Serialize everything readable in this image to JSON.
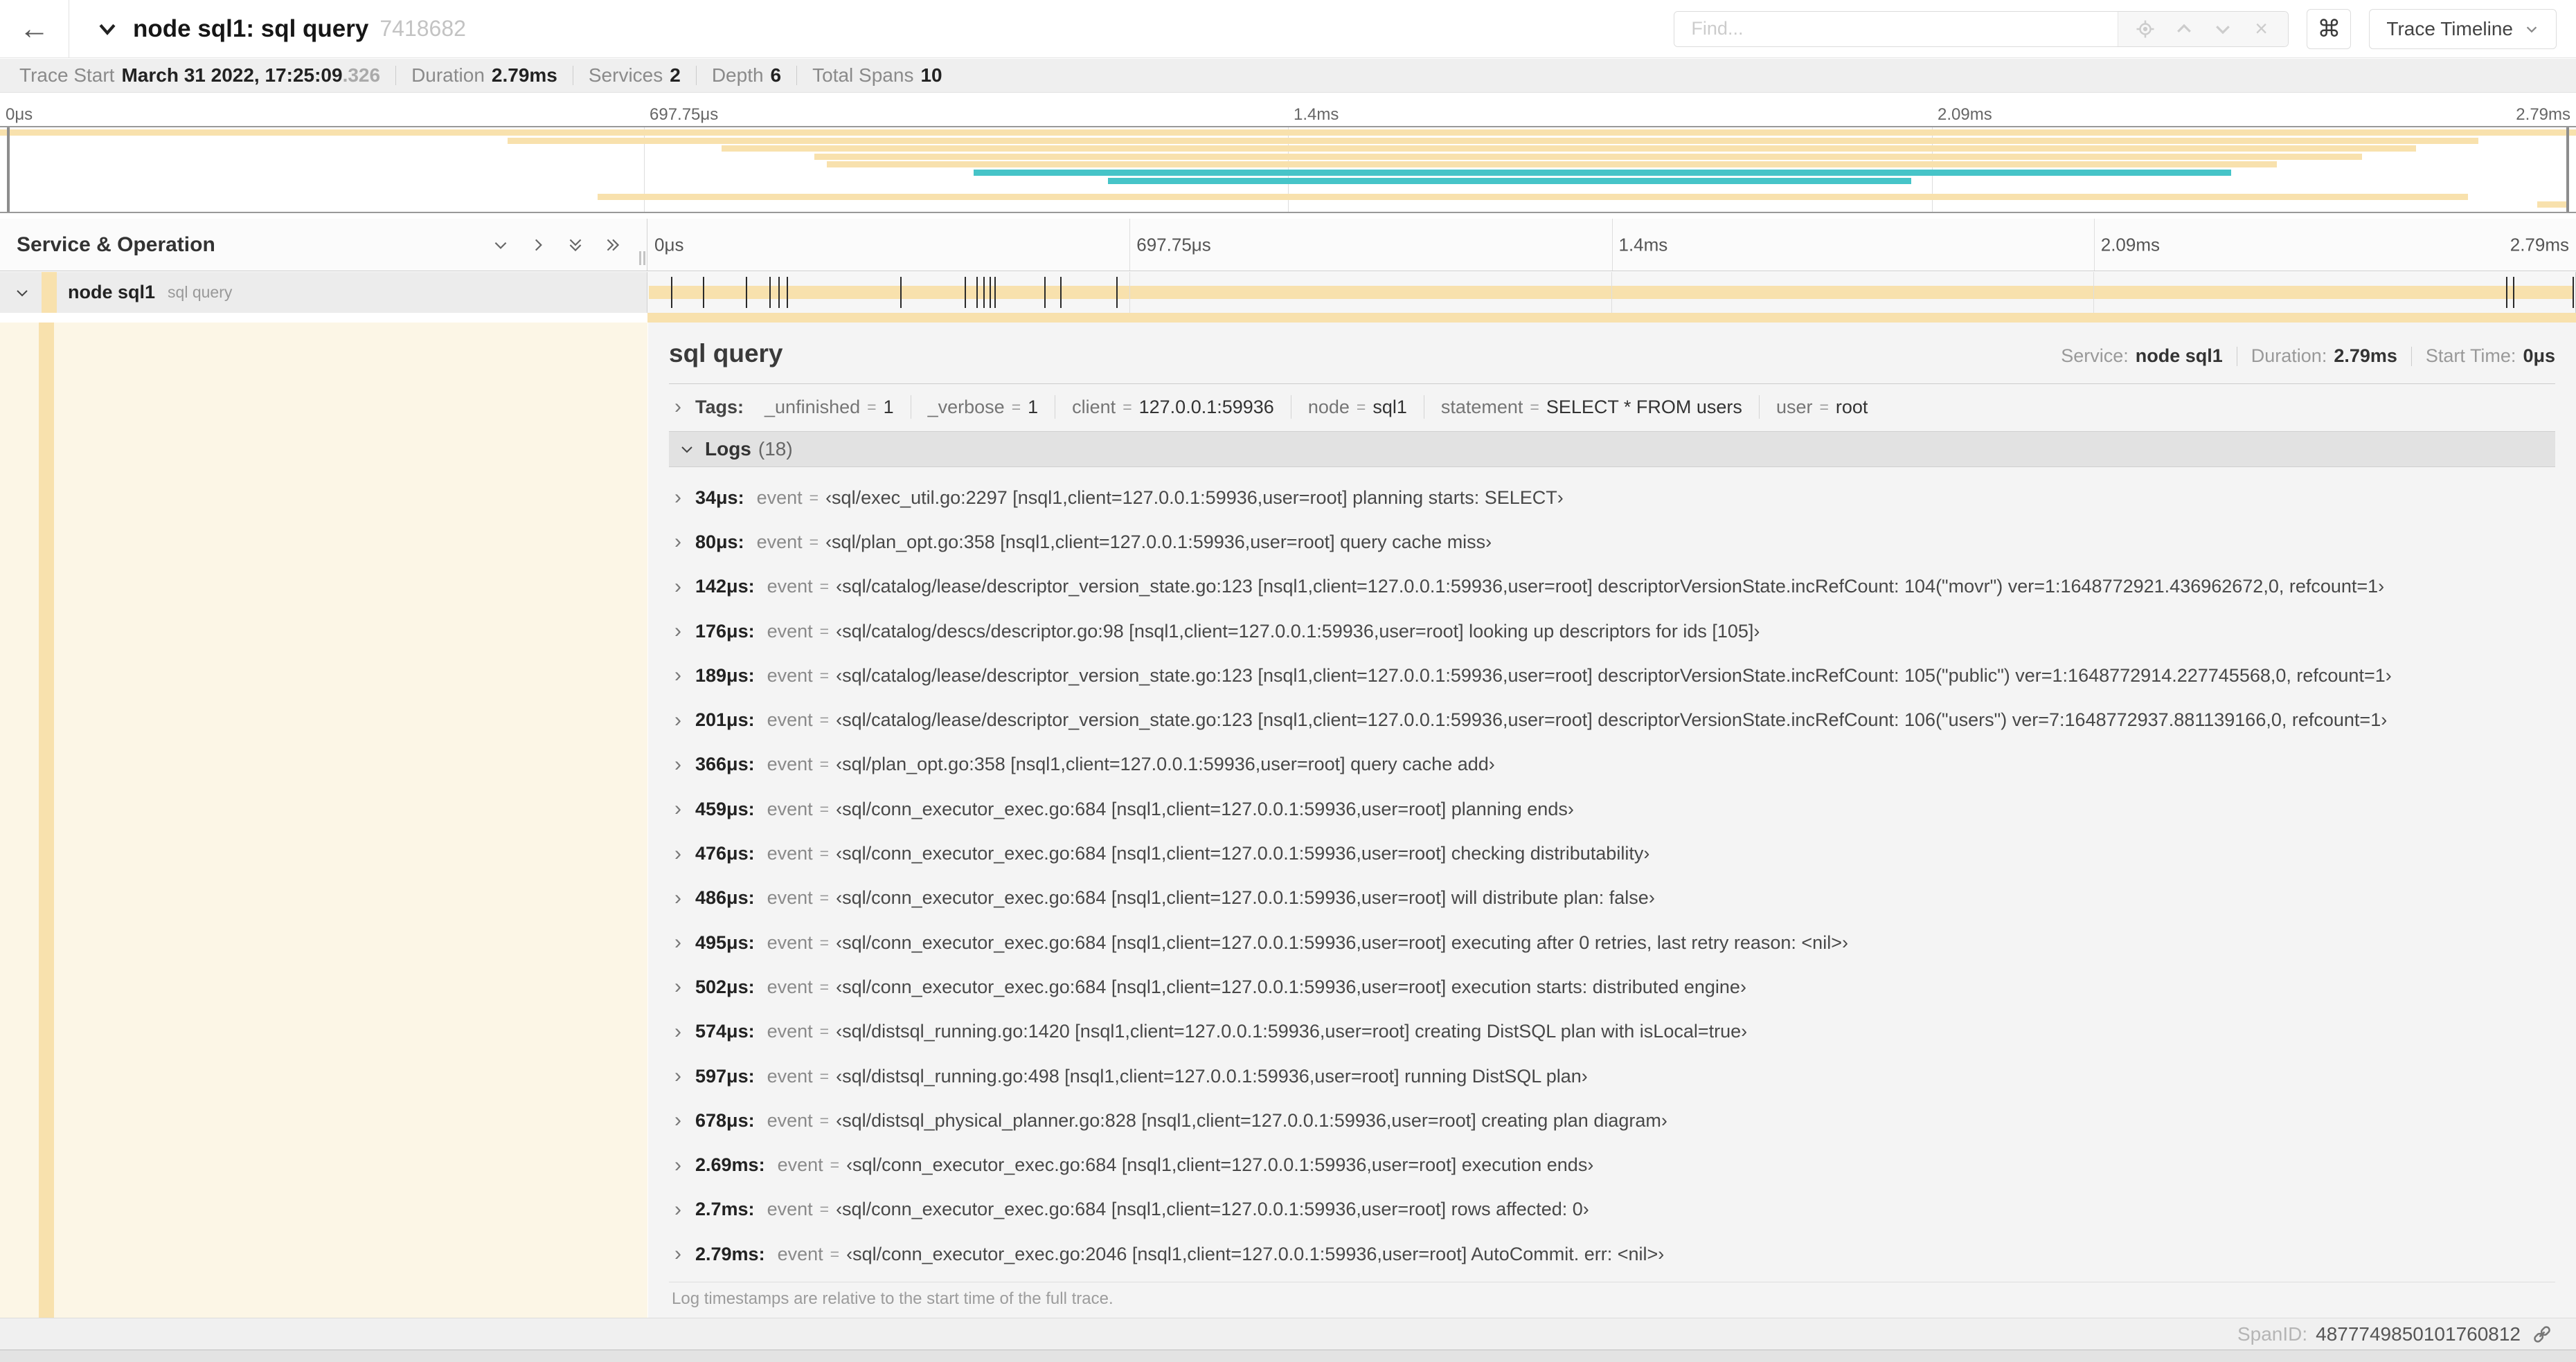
{
  "icons": {
    "back_arrow": "←",
    "clear_x": "×"
  },
  "header": {
    "title": "node sql1: sql query",
    "trace_id": "7418682",
    "find_placeholder": "Find...",
    "kbd_icon": "⌘",
    "view_label": "Trace Timeline"
  },
  "summary": {
    "items": [
      {
        "label": "Trace Start",
        "value": "March 31 2022, 17:25:09",
        "suffix": ".326"
      },
      {
        "label": "Duration",
        "value": "2.79ms"
      },
      {
        "label": "Services",
        "value": "2"
      },
      {
        "label": "Depth",
        "value": "6"
      },
      {
        "label": "Total Spans",
        "value": "10"
      }
    ]
  },
  "timeline": {
    "duration_us": 2790,
    "ticks": [
      {
        "label": "0μs",
        "pos": 0
      },
      {
        "label": "697.75μs",
        "pos": 0.25
      },
      {
        "label": "1.4ms",
        "pos": 0.5
      },
      {
        "label": "2.09ms",
        "pos": 0.75
      },
      {
        "label": "2.79ms",
        "pos": 1
      }
    ],
    "colors": {
      "tan": "#f8e1ad",
      "teal": "#46c4c8"
    },
    "minimap_rows": [
      {
        "color": "tan",
        "start": 0.0,
        "end": 1.0
      },
      {
        "color": "tan",
        "start": 0.197,
        "end": 0.962
      },
      {
        "color": "tan",
        "start": 0.28,
        "end": 0.938
      },
      {
        "color": "tan",
        "start": 0.316,
        "end": 0.917
      },
      {
        "color": "tan",
        "start": 0.321,
        "end": 0.884
      },
      {
        "color": "teal",
        "start": 0.378,
        "end": 0.866
      },
      {
        "color": "teal",
        "start": 0.43,
        "end": 0.742
      },
      {
        "color": "none",
        "start": 0,
        "end": 0
      },
      {
        "color": "tan",
        "start": 0.232,
        "end": 0.958
      },
      {
        "color": "tan",
        "start": 0.985,
        "end": 0.997
      }
    ]
  },
  "span_list": {
    "header_label": "Service & Operation",
    "row": {
      "service": "node sql1",
      "operation": "sql query",
      "color": "tan"
    }
  },
  "detail": {
    "title": "sql query",
    "overview": [
      {
        "label": "Service:",
        "value": "node sql1"
      },
      {
        "label": "Duration:",
        "value": "2.79ms"
      },
      {
        "label": "Start Time:",
        "value": "0μs"
      }
    ],
    "tags": {
      "label": "Tags:",
      "equals_sign": "=",
      "items": [
        {
          "key": "_unfinished",
          "value": "1"
        },
        {
          "key": "_verbose",
          "value": "1"
        },
        {
          "key": "client",
          "value": "127.0.0.1:59936"
        },
        {
          "key": "node",
          "value": "sql1"
        },
        {
          "key": "statement",
          "value": "SELECT * FROM users"
        },
        {
          "key": "user",
          "value": "root"
        }
      ]
    },
    "logs": {
      "label": "Logs",
      "count": "(18)",
      "toggle_glyph": "›",
      "equals_sign": "=",
      "field_key": "event",
      "entries": [
        {
          "t": "34μs:",
          "t_us": 34,
          "value": "‹sql/exec_util.go:2297 [nsql1,client=127.0.0.1:59936,user=root] planning starts: SELECT›"
        },
        {
          "t": "80μs:",
          "t_us": 80,
          "value": "‹sql/plan_opt.go:358 [nsql1,client=127.0.0.1:59936,user=root] query cache miss›"
        },
        {
          "t": "142μs:",
          "t_us": 142,
          "value": "‹sql/catalog/lease/descriptor_version_state.go:123 [nsql1,client=127.0.0.1:59936,user=root] descriptorVersionState.incRefCount: 104(\"movr\") ver=1:1648772921.436962672,0, refcount=1›"
        },
        {
          "t": "176μs:",
          "t_us": 176,
          "value": "‹sql/catalog/descs/descriptor.go:98 [nsql1,client=127.0.0.1:59936,user=root] looking up descriptors for ids [105]›"
        },
        {
          "t": "189μs:",
          "t_us": 189,
          "value": "‹sql/catalog/lease/descriptor_version_state.go:123 [nsql1,client=127.0.0.1:59936,user=root] descriptorVersionState.incRefCount: 105(\"public\") ver=1:1648772914.227745568,0, refcount=1›"
        },
        {
          "t": "201μs:",
          "t_us": 201,
          "value": "‹sql/catalog/lease/descriptor_version_state.go:123 [nsql1,client=127.0.0.1:59936,user=root] descriptorVersionState.incRefCount: 106(\"users\") ver=7:1648772937.881139166,0, refcount=1›"
        },
        {
          "t": "366μs:",
          "t_us": 366,
          "value": "‹sql/plan_opt.go:358 [nsql1,client=127.0.0.1:59936,user=root] query cache add›"
        },
        {
          "t": "459μs:",
          "t_us": 459,
          "value": "‹sql/conn_executor_exec.go:684 [nsql1,client=127.0.0.1:59936,user=root] planning ends›"
        },
        {
          "t": "476μs:",
          "t_us": 476,
          "value": "‹sql/conn_executor_exec.go:684 [nsql1,client=127.0.0.1:59936,user=root] checking distributability›"
        },
        {
          "t": "486μs:",
          "t_us": 486,
          "value": "‹sql/conn_executor_exec.go:684 [nsql1,client=127.0.0.1:59936,user=root] will distribute plan: false›"
        },
        {
          "t": "495μs:",
          "t_us": 495,
          "value": "‹sql/conn_executor_exec.go:684 [nsql1,client=127.0.0.1:59936,user=root] executing after 0 retries, last retry reason: <nil>›"
        },
        {
          "t": "502μs:",
          "t_us": 502,
          "value": "‹sql/conn_executor_exec.go:684 [nsql1,client=127.0.0.1:59936,user=root] execution starts: distributed engine›"
        },
        {
          "t": "574μs:",
          "t_us": 574,
          "value": "‹sql/distsql_running.go:1420 [nsql1,client=127.0.0.1:59936,user=root] creating DistSQL plan with isLocal=true›"
        },
        {
          "t": "597μs:",
          "t_us": 597,
          "value": "‹sql/distsql_running.go:498 [nsql1,client=127.0.0.1:59936,user=root] running DistSQL plan›"
        },
        {
          "t": "678μs:",
          "t_us": 678,
          "value": "‹sql/distsql_physical_planner.go:828 [nsql1,client=127.0.0.1:59936,user=root] creating plan diagram›"
        },
        {
          "t": "2.69ms:",
          "t_us": 2690,
          "value": "‹sql/conn_executor_exec.go:684 [nsql1,client=127.0.0.1:59936,user=root] execution ends›"
        },
        {
          "t": "2.7ms:",
          "t_us": 2700,
          "value": "‹sql/conn_executor_exec.go:684 [nsql1,client=127.0.0.1:59936,user=root] rows affected: 0›"
        },
        {
          "t": "2.79ms:",
          "t_us": 2790,
          "value": "‹sql/conn_executor_exec.go:2046 [nsql1,client=127.0.0.1:59936,user=root] AutoCommit. err: <nil>›"
        }
      ],
      "footnote": "Log timestamps are relative to the start time of the full trace."
    },
    "footer": {
      "span_id_label": "SpanID:",
      "span_id": "4877749850101760812"
    }
  }
}
